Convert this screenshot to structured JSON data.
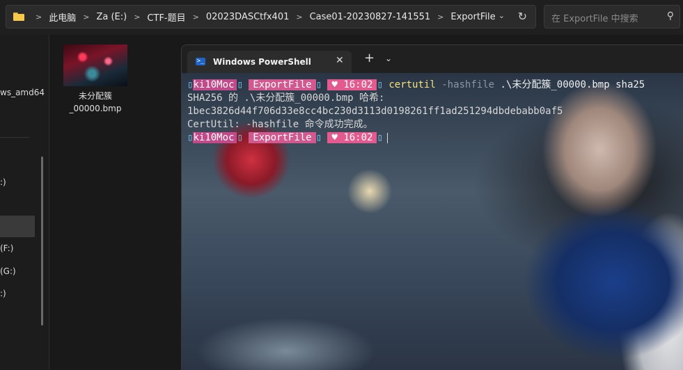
{
  "explorer": {
    "breadcrumb": [
      "此电脑",
      "Za (E:)",
      "CTF-题目",
      "02023DASCtfx401",
      "Case01-20230827-141551",
      "ExportFile"
    ],
    "search_placeholder": "在 ExportFile 中搜索",
    "sidebar": {
      "item_amd64": "ws_amd64",
      "item_c": ":)",
      "item_f": "(F:)",
      "item_g": "(G:)",
      "item_h": ":)"
    },
    "file": {
      "name_line1": "未分配簇",
      "name_line2": "_00000.bmp"
    }
  },
  "powershell": {
    "tab_title": "Windows PowerShell",
    "new_tab": "+",
    "prompt": {
      "user": "ki10Moc",
      "dir": "ExportFile",
      "time": "♥ 16:02"
    },
    "command": {
      "name": "certutil",
      "param": "-hashfile",
      "args": ".\\未分配簇_00000.bmp sha25"
    },
    "output": [
      "SHA256 的 .\\未分配簇_00000.bmp 哈希:",
      "1bec3826d44f706d33e8cc4bc230d3113d0198261ff1ad251294dbdebabb0af5",
      "CertUtil: -hashfile 命令成功完成。"
    ]
  },
  "colors": {
    "prompt_user": "#c04a8a",
    "prompt_dir": "#d2598f",
    "prompt_time": "#e25a8e",
    "command": "#f5e27a",
    "folder": "#f6c94a"
  }
}
